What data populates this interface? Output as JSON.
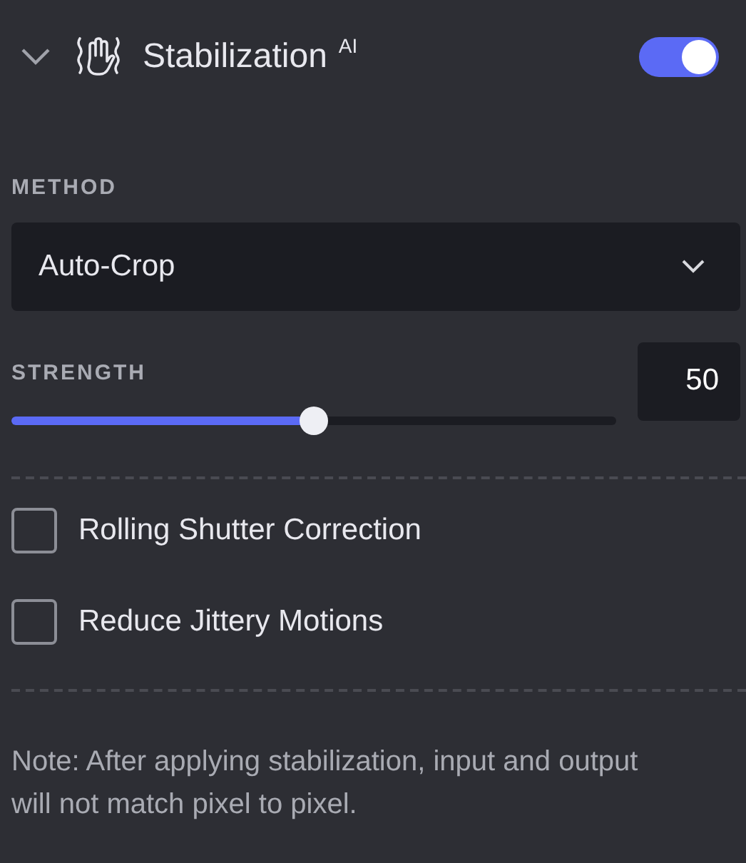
{
  "header": {
    "expanded": true,
    "title": "Stabilization",
    "badge": "AI",
    "enabled": true
  },
  "method": {
    "label": "METHOD",
    "value": "Auto-Crop"
  },
  "strength": {
    "label": "STRENGTH",
    "level": 0.5,
    "value": "50"
  },
  "options": [
    {
      "label": "Rolling Shutter Correction",
      "checked": false
    },
    {
      "label": "Reduce Jittery Motions",
      "checked": false
    }
  ],
  "note": "Note: After applying stabilization, input and output will not match pixel to pixel."
}
